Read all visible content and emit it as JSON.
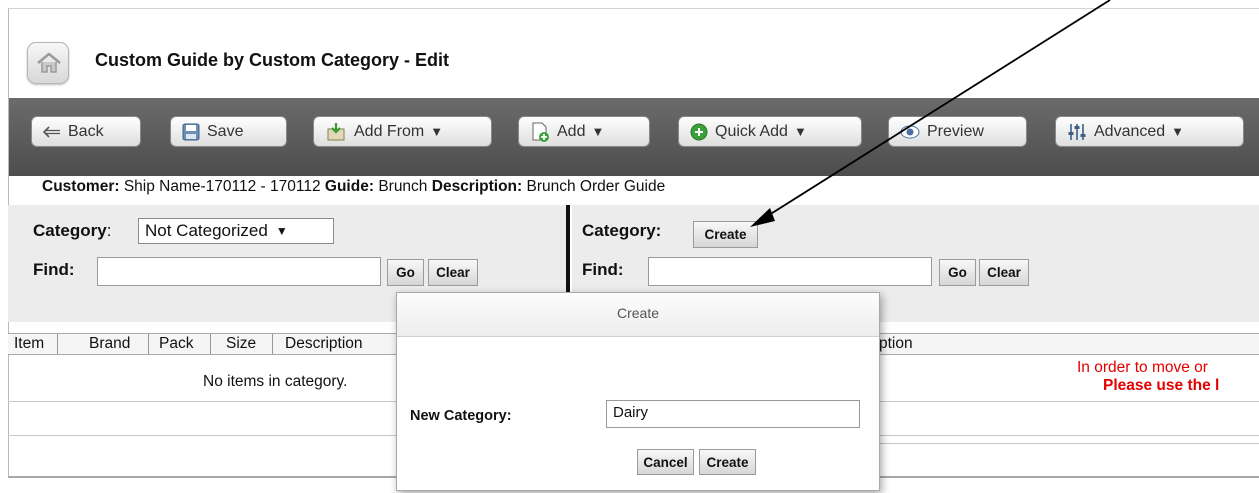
{
  "header": {
    "title": "Custom Guide by Custom Category - Edit",
    "home_icon": "home-icon"
  },
  "toolbar": {
    "back": "Back",
    "save": "Save",
    "add_from": "Add From",
    "add": "Add",
    "quick_add": "Quick Add",
    "preview": "Preview",
    "advanced": "Advanced"
  },
  "info": {
    "customer_label": "Customer:",
    "customer_value": "Ship Name-170112 - 170112",
    "guide_label": "Guide:",
    "guide_value": "Brunch",
    "description_label": "Description:",
    "description_value": "Brunch Order Guide"
  },
  "left_panel": {
    "category_label": "Category",
    "category_colon": ":",
    "category_selected": "Not Categorized",
    "find_label": "Find:",
    "find_value": "",
    "go": "Go",
    "clear": "Clear"
  },
  "right_panel": {
    "category_label": "Category:",
    "create": "Create",
    "find_label": "Find:",
    "find_value": "",
    "go": "Go",
    "clear": "Clear"
  },
  "table": {
    "columns": [
      "Item",
      "Brand",
      "Pack",
      "Size",
      "Description"
    ],
    "right_column_fragment": "ption",
    "empty_message": "No items in category.",
    "warning_line1": "In order to move or",
    "warning_line2": "Please use the l"
  },
  "dialog": {
    "title": "Create",
    "new_category_label": "New Category:",
    "new_category_value": "Dairy",
    "cancel": "Cancel",
    "create": "Create"
  },
  "colors": {
    "toolbar_bg": "#555555",
    "warning": "#e60000"
  }
}
